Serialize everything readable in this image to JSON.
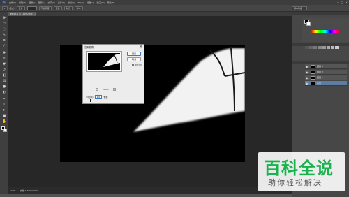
{
  "app": {
    "logo": "Ps",
    "window_controls": [
      "–",
      "□",
      "×"
    ]
  },
  "menu": [
    "文件(F)",
    "编辑(E)",
    "图像(I)",
    "图层(L)",
    "文字(Y)",
    "选择(S)",
    "滤镜(T)",
    "3D(D)",
    "视图(V)",
    "窗口(W)",
    "帮助(H)"
  ],
  "options_bar": {
    "mode": "模式:",
    "buttons": [
      "正常",
      "不透明度",
      "流量",
      "对齐",
      "样本"
    ],
    "workspace": "基本功能"
  },
  "document": {
    "tab": "未标题-1 @ 100%(图层 1,RGB/8)"
  },
  "status": {
    "zoom": "100%",
    "doc_info": "文档:1.28M/3.78M"
  },
  "dialog": {
    "title": "高斯模糊",
    "close_icon": "×",
    "ok": "确定",
    "cancel": "取消",
    "preview_label": "预览(P)",
    "zoom_out": "-",
    "zoom_value": "100%",
    "zoom_in": "+",
    "radius_label": "半径(R):",
    "radius_value": "1.0",
    "radius_unit": "像素",
    "radius_level": 0.1
  },
  "layers": [
    {
      "name": "图层 3",
      "selected": false
    },
    {
      "name": "图层 2",
      "selected": false
    },
    {
      "name": "图层 1",
      "selected": false
    },
    {
      "name": "背景",
      "selected": true
    }
  ],
  "watermark": {
    "title": "百科全说",
    "subtitle": "助你轻松解决"
  }
}
